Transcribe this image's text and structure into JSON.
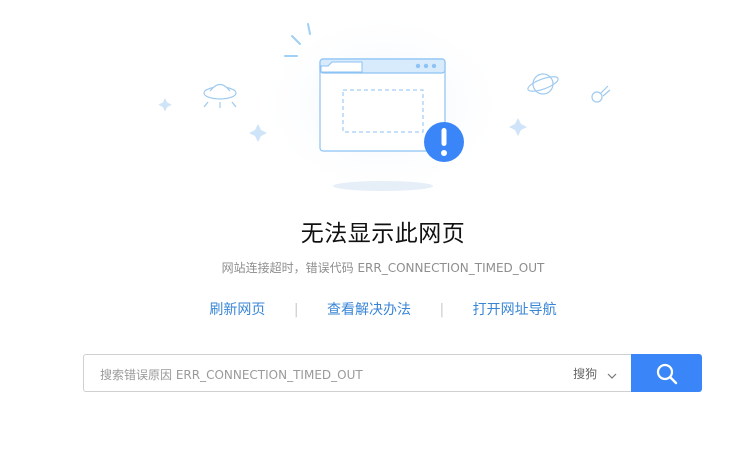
{
  "page": {
    "title": "无法显示此网页",
    "subtitle": "网站连接超时，错误代码 ERR_CONNECTION_TIMED_OUT"
  },
  "links": {
    "refresh": "刷新网页",
    "solutions": "查看解决办法",
    "navigation": "打开网址导航"
  },
  "search": {
    "placeholder": "搜索错误原因 ERR_CONNECTION_TIMED_OUT",
    "engine": "搜狗"
  },
  "icons": {
    "error": "exclamation-icon",
    "search": "search-icon",
    "engine_dropdown": "chevron-down-icon"
  },
  "colors": {
    "accent": "#3a86f8",
    "link": "#3a86d6",
    "illustration_line": "#8cc2f4"
  }
}
